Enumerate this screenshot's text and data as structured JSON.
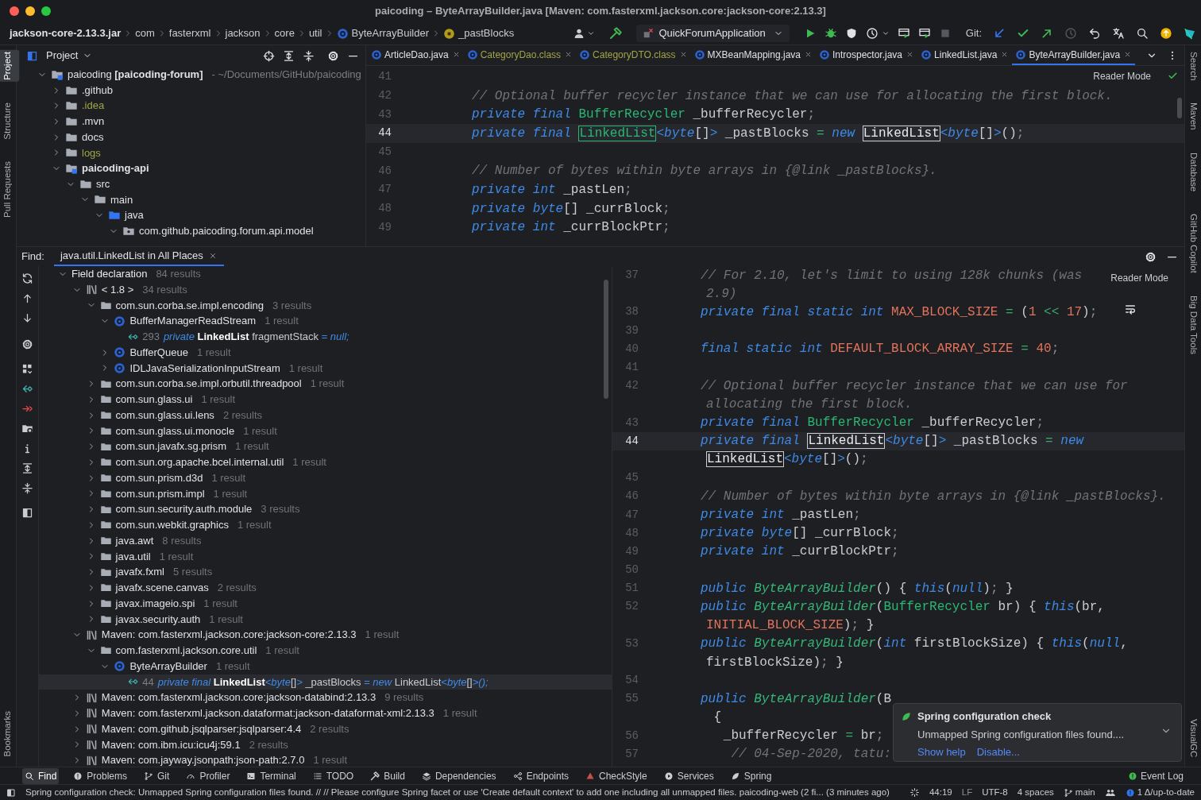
{
  "window": {
    "title": "paicoding – ByteArrayBuilder.java [Maven: com.fasterxml.jackson.core:jackson-core:2.13.3]"
  },
  "breadcrumbs": [
    {
      "label": "jackson-core-2.13.3.jar"
    },
    {
      "label": "com"
    },
    {
      "label": "fasterxml"
    },
    {
      "label": "jackson"
    },
    {
      "label": "core"
    },
    {
      "label": "util"
    },
    {
      "label": "ByteArrayBuilder"
    },
    {
      "label": "_pastBlocks"
    }
  ],
  "toolbar": {
    "run_configuration": "QuickForumApplication",
    "git_label": "Git:"
  },
  "left_tool_windows": [
    {
      "label": "Project",
      "selected": true
    },
    {
      "label": "Structure",
      "selected": false
    },
    {
      "label": "Pull Requests",
      "selected": false
    },
    {
      "label": "Bookmarks",
      "selected": false
    }
  ],
  "right_tool_windows": [
    {
      "label": "Search",
      "selected": false
    },
    {
      "label": "Maven",
      "selected": false
    },
    {
      "label": "Database",
      "selected": false
    },
    {
      "label": "GitHub Copilot",
      "selected": false
    },
    {
      "label": "Big Data Tools",
      "selected": false
    },
    {
      "label": "VisualGC",
      "selected": false
    }
  ],
  "project_panel": {
    "title": "Project",
    "tree": [
      {
        "label": "paicoding **[paicoding-forum]**",
        "path": "- ~/Documents/GitHub/paicoding",
        "kind": "project",
        "ignored": false,
        "expanded": true,
        "children": [
          {
            "label": ".github",
            "kind": "folder",
            "ignored": false,
            "expanded": false
          },
          {
            "label": ".idea",
            "kind": "folder",
            "ignored": true,
            "expanded": false
          },
          {
            "label": ".mvn",
            "kind": "folder",
            "ignored": false,
            "expanded": false
          },
          {
            "label": "docs",
            "kind": "folder",
            "ignored": false,
            "expanded": false
          },
          {
            "label": "logs",
            "kind": "folder",
            "ignored": true,
            "expanded": false
          },
          {
            "label": "paicoding-api",
            "kind": "module",
            "ignored": false,
            "expanded": true,
            "children": [
              {
                "label": "src",
                "kind": "folder",
                "ignored": false,
                "expanded": true,
                "children": [
                  {
                    "label": "main",
                    "kind": "folder",
                    "ignored": false,
                    "expanded": true,
                    "children": [
                      {
                        "label": "java",
                        "kind": "source",
                        "ignored": false,
                        "expanded": true,
                        "children": [
                          {
                            "label": "com.github.paicoding.forum.api.model",
                            "kind": "package",
                            "ignored": false,
                            "expanded": true
                          }
                        ]
                      }
                    ]
                  }
                ]
              }
            ]
          }
        ]
      }
    ]
  },
  "editor_tabs": [
    {
      "label": "ArticleDao.java",
      "ignored": false,
      "selected": false
    },
    {
      "label": "CategoryDao.class",
      "ignored": true,
      "selected": false
    },
    {
      "label": "CategoryDTO.class",
      "ignored": true,
      "selected": false
    },
    {
      "label": "MXBeanMapping.java",
      "ignored": false,
      "selected": false
    },
    {
      "label": "Introspector.java",
      "ignored": false,
      "selected": false
    },
    {
      "label": "LinkedList.java",
      "ignored": false,
      "selected": false
    },
    {
      "label": "ByteArrayBuilder.java",
      "ignored": false,
      "selected": true
    }
  ],
  "top_editor": {
    "reader_mode": "Reader Mode",
    "lines": [
      {
        "number": "41",
        "current": false
      },
      {
        "number": "42",
        "current": false,
        "segments": [
          {
            "kind": "comment",
            "text": "// Optional buffer recycler instance that we can use for allocating the first block."
          }
        ]
      },
      {
        "number": "43",
        "current": false,
        "segments": [
          {
            "kind": "kw",
            "text": "private final "
          },
          {
            "kind": "type",
            "text": "BufferRecycler"
          },
          {
            "kind": "plain",
            "text": " _bufferRecycler"
          },
          {
            "kind": "punct",
            "text": ";"
          }
        ]
      },
      {
        "number": "44",
        "current": true,
        "segments": [
          {
            "kind": "kw",
            "text": "private final "
          },
          {
            "kind": "match_type",
            "text": "LinkedList"
          },
          {
            "kind": "kw",
            "text": "<byte"
          },
          {
            "kind": "plain",
            "text": "[]"
          },
          {
            "kind": "kw",
            "text": ">"
          },
          {
            "kind": "plain",
            "text": " _pastBlocks "
          },
          {
            "kind": "op",
            "text": "="
          },
          {
            "kind": "kw",
            "text": " new "
          },
          {
            "kind": "match",
            "text": "LinkedList"
          },
          {
            "kind": "kw",
            "text": "<byte"
          },
          {
            "kind": "plain",
            "text": "[]"
          },
          {
            "kind": "kw",
            "text": ">"
          },
          {
            "kind": "plain",
            "text": "()"
          },
          {
            "kind": "punct",
            "text": ";"
          }
        ]
      },
      {
        "number": "45",
        "current": false
      },
      {
        "number": "46",
        "current": false,
        "segments": [
          {
            "kind": "comment",
            "text": "// Number of bytes within byte arrays in {@link _pastBlocks}."
          }
        ]
      },
      {
        "number": "47",
        "current": false,
        "segments": [
          {
            "kind": "kw",
            "text": "private int "
          },
          {
            "kind": "plain",
            "text": "_pastLen"
          },
          {
            "kind": "punct",
            "text": ";"
          }
        ]
      },
      {
        "number": "48",
        "current": false,
        "segments": [
          {
            "kind": "kw",
            "text": "private byte"
          },
          {
            "kind": "plain",
            "text": "[] _currBlock"
          },
          {
            "kind": "punct",
            "text": ";"
          }
        ]
      },
      {
        "number": "49",
        "current": false,
        "segments": [
          {
            "kind": "kw",
            "text": "private int "
          },
          {
            "kind": "plain",
            "text": "_currBlockPtr"
          },
          {
            "kind": "punct",
            "text": ";"
          }
        ]
      }
    ]
  },
  "find_panel": {
    "label": "Find:",
    "tab": "java.util.LinkedList in All Places",
    "tree": [
      {
        "kind": "category",
        "label": "Field declaration",
        "count": "84 results",
        "expanded": true,
        "selected": false,
        "children": [
          {
            "kind": "library",
            "label": "< 1.8 >",
            "count": "34 results",
            "expanded": true,
            "selected": false,
            "children": [
              {
                "kind": "package",
                "label": "com.sun.corba.se.impl.encoding",
                "count": "3 results",
                "expanded": true,
                "selected": false,
                "children": [
                  {
                    "kind": "class",
                    "label": "BufferManagerReadStream",
                    "count": "1 result",
                    "expanded": true,
                    "selected": false,
                    "children": [
                      {
                        "kind": "usage",
                        "line": "293",
                        "selected": false,
                        "segments": [
                          {
                            "kind": "kw",
                            "text": "private "
                          },
                          {
                            "kind": "bold",
                            "text": "LinkedList"
                          },
                          {
                            "kind": "plain",
                            "text": " fragmentStack "
                          },
                          {
                            "kind": "kw",
                            "text": "= null;"
                          }
                        ]
                      }
                    ]
                  },
                  {
                    "kind": "class",
                    "label": "BufferQueue",
                    "count": "1 result",
                    "expanded": false,
                    "selected": false
                  },
                  {
                    "kind": "class",
                    "label": "IDLJavaSerializationInputStream",
                    "count": "1 result",
                    "expanded": false,
                    "selected": false
                  }
                ]
              },
              {
                "kind": "package",
                "label": "com.sun.corba.se.impl.orbutil.threadpool",
                "count": "1 result",
                "expanded": false,
                "selected": false
              },
              {
                "kind": "package",
                "label": "com.sun.glass.ui",
                "count": "1 result",
                "expanded": false,
                "selected": false
              },
              {
                "kind": "package",
                "label": "com.sun.glass.ui.lens",
                "count": "2 results",
                "expanded": false,
                "selected": false
              },
              {
                "kind": "package",
                "label": "com.sun.glass.ui.monocle",
                "count": "1 result",
                "expanded": false,
                "selected": false
              },
              {
                "kind": "package",
                "label": "com.sun.javafx.sg.prism",
                "count": "1 result",
                "expanded": false,
                "selected": false
              },
              {
                "kind": "package",
                "label": "com.sun.org.apache.bcel.internal.util",
                "count": "1 result",
                "expanded": false,
                "selected": false
              },
              {
                "kind": "package",
                "label": "com.sun.prism.d3d",
                "count": "1 result",
                "expanded": false,
                "selected": false
              },
              {
                "kind": "package",
                "label": "com.sun.prism.impl",
                "count": "1 result",
                "expanded": false,
                "selected": false
              },
              {
                "kind": "package",
                "label": "com.sun.security.auth.module",
                "count": "3 results",
                "expanded": false,
                "selected": false
              },
              {
                "kind": "package",
                "label": "com.sun.webkit.graphics",
                "count": "1 result",
                "expanded": false,
                "selected": false
              },
              {
                "kind": "package",
                "label": "java.awt",
                "count": "8 results",
                "expanded": false,
                "selected": false
              },
              {
                "kind": "package",
                "label": "java.util",
                "count": "1 result",
                "expanded": false,
                "selected": false
              },
              {
                "kind": "package",
                "label": "javafx.fxml",
                "count": "5 results",
                "expanded": false,
                "selected": false
              },
              {
                "kind": "package",
                "label": "javafx.scene.canvas",
                "count": "2 results",
                "expanded": false,
                "selected": false
              },
              {
                "kind": "package",
                "label": "javax.imageio.spi",
                "count": "1 result",
                "expanded": false,
                "selected": false
              },
              {
                "kind": "package",
                "label": "javax.security.auth",
                "count": "1 result",
                "expanded": false,
                "selected": false
              }
            ]
          },
          {
            "kind": "library",
            "label": "Maven: com.fasterxml.jackson.core:jackson-core:2.13.3",
            "count": "1 result",
            "expanded": true,
            "selected": false,
            "children": [
              {
                "kind": "package",
                "label": "com.fasterxml.jackson.core.util",
                "count": "1 result",
                "expanded": true,
                "selected": false,
                "children": [
                  {
                    "kind": "class",
                    "label": "ByteArrayBuilder",
                    "count": "1 result",
                    "expanded": true,
                    "selected": false,
                    "children": [
                      {
                        "kind": "usage",
                        "line": "44",
                        "selected": true,
                        "segments": [
                          {
                            "kind": "kw",
                            "text": "private final "
                          },
                          {
                            "kind": "bold",
                            "text": "LinkedList"
                          },
                          {
                            "kind": "kw",
                            "text": "<byte"
                          },
                          {
                            "kind": "plain",
                            "text": "[]"
                          },
                          {
                            "kind": "kw",
                            "text": ">"
                          },
                          {
                            "kind": "plain",
                            "text": " _pastBlocks "
                          },
                          {
                            "kind": "kw",
                            "text": "= new "
                          },
                          {
                            "kind": "plain",
                            "text": "LinkedList"
                          },
                          {
                            "kind": "kw",
                            "text": "<byte"
                          },
                          {
                            "kind": "plain",
                            "text": "[]"
                          },
                          {
                            "kind": "kw",
                            "text": ">();"
                          }
                        ]
                      }
                    ]
                  }
                ]
              }
            ]
          },
          {
            "kind": "library",
            "label": "Maven: com.fasterxml.jackson.core:jackson-databind:2.13.3",
            "count": "9 results",
            "expanded": false,
            "selected": false
          },
          {
            "kind": "library",
            "label": "Maven: com.fasterxml.jackson.dataformat:jackson-dataformat-xml:2.13.3",
            "count": "1 result",
            "expanded": false,
            "selected": false
          },
          {
            "kind": "library",
            "label": "Maven: com.github.jsqlparser:jsqlparser:4.4",
            "count": "2 results",
            "expanded": false,
            "selected": false
          },
          {
            "kind": "library",
            "label": "Maven: com.ibm.icu:icu4j:59.1",
            "count": "2 results",
            "expanded": false,
            "selected": false
          },
          {
            "kind": "library",
            "label": "Maven: com.jayway.jsonpath:json-path:2.7.0",
            "count": "1 result",
            "expanded": false,
            "selected": false
          }
        ]
      }
    ]
  },
  "bottom_editor": {
    "reader_mode": "Reader Mode",
    "lines": [
      {
        "number": "37",
        "current": false,
        "segments": [
          {
            "kind": "comment",
            "text": "// For 2.10, let's limit to using 128k chunks (was"
          }
        ]
      },
      {
        "current": false,
        "segments": [
          {
            "kind": "comment",
            "text": "2.9)"
          }
        ]
      },
      {
        "number": "38",
        "current": false,
        "segments": [
          {
            "kind": "kw",
            "text": "private final static int "
          },
          {
            "kind": "const",
            "text": "MAX_BLOCK_SIZE"
          },
          {
            "kind": "op",
            "text": " = "
          },
          {
            "kind": "plain",
            "text": "("
          },
          {
            "kind": "const",
            "text": "1"
          },
          {
            "kind": "op",
            "text": " << "
          },
          {
            "kind": "const",
            "text": "17"
          },
          {
            "kind": "plain",
            "text": ")"
          },
          {
            "kind": "punct",
            "text": ";"
          }
        ]
      },
      {
        "number": "39",
        "current": false
      },
      {
        "number": "40",
        "current": false,
        "segments": [
          {
            "kind": "kw",
            "text": "final static int "
          },
          {
            "kind": "const",
            "text": "DEFAULT_BLOCK_ARRAY_SIZE"
          },
          {
            "kind": "op",
            "text": " = "
          },
          {
            "kind": "const",
            "text": "40"
          },
          {
            "kind": "punct",
            "text": ";"
          }
        ]
      },
      {
        "number": "41",
        "current": false
      },
      {
        "number": "42",
        "current": false,
        "segments": [
          {
            "kind": "comment",
            "text": "// Optional buffer recycler instance that we can use for"
          }
        ]
      },
      {
        "current": false,
        "segments": [
          {
            "kind": "comment",
            "text": "allocating the first block."
          }
        ]
      },
      {
        "number": "43",
        "current": false,
        "segments": [
          {
            "kind": "kw",
            "text": "private final "
          },
          {
            "kind": "type",
            "text": "BufferRecycler"
          },
          {
            "kind": "plain",
            "text": " _bufferRecycler"
          },
          {
            "kind": "punct",
            "text": ";"
          }
        ]
      },
      {
        "number": "44",
        "current": true,
        "segments": [
          {
            "kind": "kw",
            "text": "private final "
          },
          {
            "kind": "match",
            "text": "LinkedList"
          },
          {
            "kind": "kw",
            "text": "<byte"
          },
          {
            "kind": "plain",
            "text": "[]"
          },
          {
            "kind": "kw",
            "text": ">"
          },
          {
            "kind": "plain",
            "text": " _pastBlocks "
          },
          {
            "kind": "op",
            "text": "="
          },
          {
            "kind": "kw",
            "text": " new"
          }
        ]
      },
      {
        "current": false,
        "segments": [
          {
            "kind": "match",
            "text": "LinkedList"
          },
          {
            "kind": "kw",
            "text": "<byte"
          },
          {
            "kind": "plain",
            "text": "[]"
          },
          {
            "kind": "kw",
            "text": ">"
          },
          {
            "kind": "plain",
            "text": "()"
          },
          {
            "kind": "punct",
            "text": ";"
          }
        ]
      },
      {
        "number": "45",
        "current": false
      },
      {
        "number": "46",
        "current": false,
        "segments": [
          {
            "kind": "comment",
            "text": "// Number of bytes within byte arrays in {@link _pastBlocks}."
          }
        ]
      },
      {
        "number": "47",
        "current": false,
        "segments": [
          {
            "kind": "kw",
            "text": "private int "
          },
          {
            "kind": "plain",
            "text": "_pastLen"
          },
          {
            "kind": "punct",
            "text": ";"
          }
        ]
      },
      {
        "number": "48",
        "current": false,
        "segments": [
          {
            "kind": "kw",
            "text": "private byte"
          },
          {
            "kind": "plain",
            "text": "[] _currBlock"
          },
          {
            "kind": "punct",
            "text": ";"
          }
        ]
      },
      {
        "number": "49",
        "current": false,
        "segments": [
          {
            "kind": "kw",
            "text": "private int "
          },
          {
            "kind": "plain",
            "text": "_currBlockPtr"
          },
          {
            "kind": "punct",
            "text": ";"
          }
        ]
      },
      {
        "number": "50",
        "current": false
      },
      {
        "number": "51",
        "current": false,
        "segments": [
          {
            "kind": "kw",
            "text": "public "
          },
          {
            "kind": "fn",
            "text": "ByteArrayBuilder"
          },
          {
            "kind": "plain",
            "text": "() { "
          },
          {
            "kind": "kw",
            "text": "this"
          },
          {
            "kind": "plain",
            "text": "("
          },
          {
            "kind": "kw",
            "text": "null"
          },
          {
            "kind": "plain",
            "text": ")"
          },
          {
            "kind": "punct",
            "text": ";"
          },
          {
            "kind": "plain",
            "text": " }"
          }
        ]
      },
      {
        "number": "52",
        "current": false,
        "segments": [
          {
            "kind": "kw",
            "text": "public "
          },
          {
            "kind": "fn",
            "text": "ByteArrayBuilder"
          },
          {
            "kind": "plain",
            "text": "("
          },
          {
            "kind": "type",
            "text": "BufferRecycler"
          },
          {
            "kind": "plain",
            "text": " br) { "
          },
          {
            "kind": "kw",
            "text": "this"
          },
          {
            "kind": "plain",
            "text": "(br,"
          }
        ]
      },
      {
        "current": false,
        "segments": [
          {
            "kind": "const",
            "text": "INITIAL_BLOCK_SIZE"
          },
          {
            "kind": "plain",
            "text": ")"
          },
          {
            "kind": "punct",
            "text": ";"
          },
          {
            "kind": "plain",
            "text": " }"
          }
        ]
      },
      {
        "number": "53",
        "current": false,
        "segments": [
          {
            "kind": "kw",
            "text": "public "
          },
          {
            "kind": "fn",
            "text": "ByteArrayBuilder"
          },
          {
            "kind": "plain",
            "text": "("
          },
          {
            "kind": "kw",
            "text": "int"
          },
          {
            "kind": "plain",
            "text": " firstBlockSize) { "
          },
          {
            "kind": "kw",
            "text": "this"
          },
          {
            "kind": "plain",
            "text": "("
          },
          {
            "kind": "kw",
            "text": "null"
          },
          {
            "kind": "plain",
            "text": ","
          }
        ]
      },
      {
        "current": false,
        "segments": [
          {
            "kind": "plain",
            "text": "firstBlockSize)"
          },
          {
            "kind": "punct",
            "text": ";"
          },
          {
            "kind": "plain",
            "text": " }"
          }
        ]
      },
      {
        "number": "54",
        "current": false
      },
      {
        "number": "55",
        "current": false,
        "segments": [
          {
            "kind": "kw",
            "text": "public "
          },
          {
            "kind": "fn",
            "text": "ByteArrayBuilder"
          },
          {
            "kind": "plain",
            "text": "(B"
          }
        ]
      },
      {
        "current": false,
        "segments": [
          {
            "kind": "plain",
            "text": " {"
          }
        ]
      },
      {
        "number": "56",
        "current": false,
        "segments": [
          {
            "kind": "plain",
            "text": "   _bufferRecycler "
          },
          {
            "kind": "op",
            "text": "="
          },
          {
            "kind": "plain",
            "text": " br"
          },
          {
            "kind": "punct",
            "text": ";"
          }
        ]
      },
      {
        "number": "57",
        "current": false,
        "segments": [
          {
            "kind": "comment",
            "text": "    // 04-Sep-2020, tatu:"
          }
        ]
      }
    ]
  },
  "notification": {
    "title": "Spring configuration check",
    "message": "Unmapped Spring configuration files found....",
    "actions": [
      "Show help",
      "Disable..."
    ]
  },
  "bottom_toolbar": {
    "items": [
      {
        "label": "Find",
        "selected": true
      },
      {
        "label": "Problems",
        "selected": false
      },
      {
        "label": "Git",
        "selected": false
      },
      {
        "label": "Profiler",
        "selected": false
      },
      {
        "label": "Terminal",
        "selected": false
      },
      {
        "label": "TODO",
        "selected": false
      },
      {
        "label": "Build",
        "selected": false
      },
      {
        "label": "Dependencies",
        "selected": false
      },
      {
        "label": "Endpoints",
        "selected": false
      },
      {
        "label": "CheckStyle",
        "selected": false
      },
      {
        "label": "Services",
        "selected": false
      },
      {
        "label": "Spring",
        "selected": false
      }
    ],
    "event_log": "Event Log"
  },
  "status_bar": {
    "message": "Spring configuration check: Unmapped Spring configuration files found. // // Please configure Spring facet or use 'Create default context' to add one including all unmapped files. paicoding-web (2 fi... (3 minutes ago)",
    "position": "44:19",
    "line_separator": "LF",
    "encoding": "UTF-8",
    "indent": "4 spaces",
    "branch": "main",
    "vcs_status": "1 Δ/up-to-date"
  }
}
